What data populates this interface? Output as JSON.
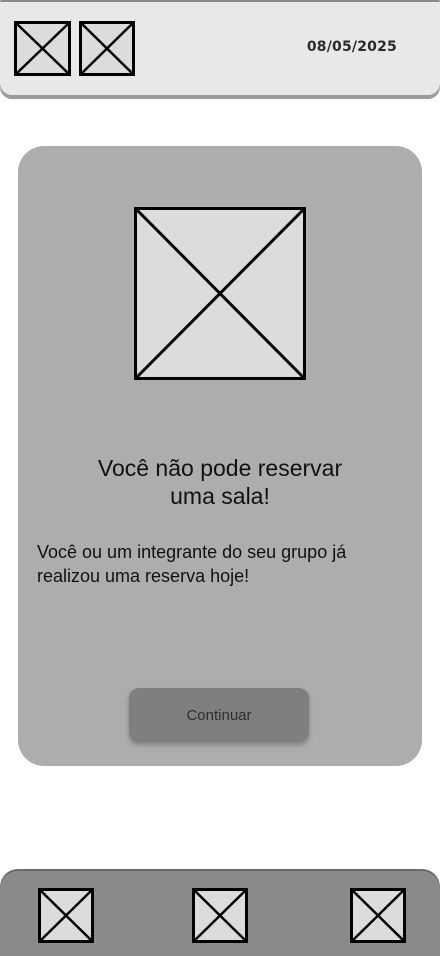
{
  "header": {
    "date": "08/05/2025",
    "icons": [
      "image-placeholder-icon",
      "image-placeholder-icon"
    ]
  },
  "dialog": {
    "title_line1": "Você não pode reservar",
    "title_line2": "uma sala!",
    "message": "Você ou um integrante do seu grupo já realizou uma reserva hoje!",
    "continue_label": "Continuar",
    "image_icon": "image-placeholder-icon"
  },
  "bottom_nav": {
    "items": [
      {
        "icon": "image-placeholder-icon"
      },
      {
        "icon": "image-placeholder-icon"
      },
      {
        "icon": "image-placeholder-icon"
      }
    ]
  },
  "colors": {
    "header_bg": "#e8e8e8",
    "card_bg": "#adadad",
    "button_bg": "#7f7f7f",
    "nav_bg": "#8a8a8a",
    "placeholder_fill": "#dcdcdc"
  }
}
